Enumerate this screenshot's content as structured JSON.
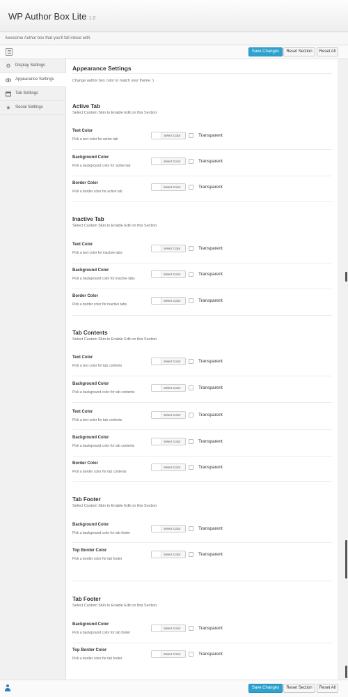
{
  "app": {
    "title": "WP Author Box Lite",
    "version": "1.0",
    "tagline": "Awesome Author box that you'll fall inlove with."
  },
  "toolbar": {
    "save_label": "Save Changes",
    "reset_section_label": "Reset Section",
    "reset_all_label": "Reset All"
  },
  "footer": {
    "save_label": "Save Changes",
    "reset_section_label": "Reset Section",
    "reset_all_label": "Reset All"
  },
  "sidebar": {
    "items": [
      {
        "label": "Display Settings",
        "icon": "gear-icon",
        "active": false
      },
      {
        "label": "Appearance Settings",
        "icon": "eye-icon",
        "active": true
      },
      {
        "label": "Tab Settings",
        "icon": "tab-icon",
        "active": false
      },
      {
        "label": "Social Settings",
        "icon": "star-icon",
        "active": false
      }
    ]
  },
  "page": {
    "title": "Appearance Settings",
    "description": "Change author box color to match your theme :)"
  },
  "common": {
    "picker_label": "Select Color",
    "transparent_label": "Transparent"
  },
  "sections": [
    {
      "title": "Active Tab",
      "desc": "Select Custom Skin to Enable Edit on this Section",
      "rows": [
        {
          "title": "Text Color",
          "desc": "Pick a text color for active tab"
        },
        {
          "title": "Background Color",
          "desc": "Pick a background color for active tab"
        },
        {
          "title": "Border Color",
          "desc": "Pick a border color for active tab"
        }
      ]
    },
    {
      "title": "Inactive Tab",
      "desc": "Select Custom Skin to Enable Edit on this Section",
      "rows": [
        {
          "title": "Text Color",
          "desc": "Pick a text color for inactive tabs"
        },
        {
          "title": "Background Color",
          "desc": "Pick a background color for inactive tabs"
        },
        {
          "title": "Border Color",
          "desc": "Pick a border color for inactive tabs"
        }
      ]
    },
    {
      "title": "Tab Contents",
      "desc": "Select Custom Skin to Enable Edit on this Section",
      "rows": [
        {
          "title": "Text Color",
          "desc": "Pick a text color for tab contents"
        },
        {
          "title": "Background Color",
          "desc": "Pick a background color for tab contents"
        },
        {
          "title": "Text Color",
          "desc": "Pick a text color for tab contents"
        },
        {
          "title": "Background Color",
          "desc": "Pick a background color for tab contents"
        },
        {
          "title": "Border Color",
          "desc": "Pick a border color for tab contents"
        }
      ]
    },
    {
      "title": "Tab Footer",
      "desc": "Select Custom Skin to Enable Edit on this Section",
      "rows": [
        {
          "title": "Background Color",
          "desc": "Pick a background color for tab footer"
        },
        {
          "title": "Top Border Color",
          "desc": "Pick a border color for tab footer"
        }
      ]
    },
    {
      "title": "Tab Footer",
      "desc": "Select Custom Skin to Enable Edit on this Section",
      "rows": [
        {
          "title": "Background Color",
          "desc": "Pick a background color for tab footer"
        },
        {
          "title": "Top Border Color",
          "desc": "Pick a border color for tab footer"
        }
      ]
    }
  ],
  "colors": {
    "primary": "#2ea2cc",
    "sidebar_bg": "#f1f1f1",
    "content_bg": "#ffffff"
  }
}
